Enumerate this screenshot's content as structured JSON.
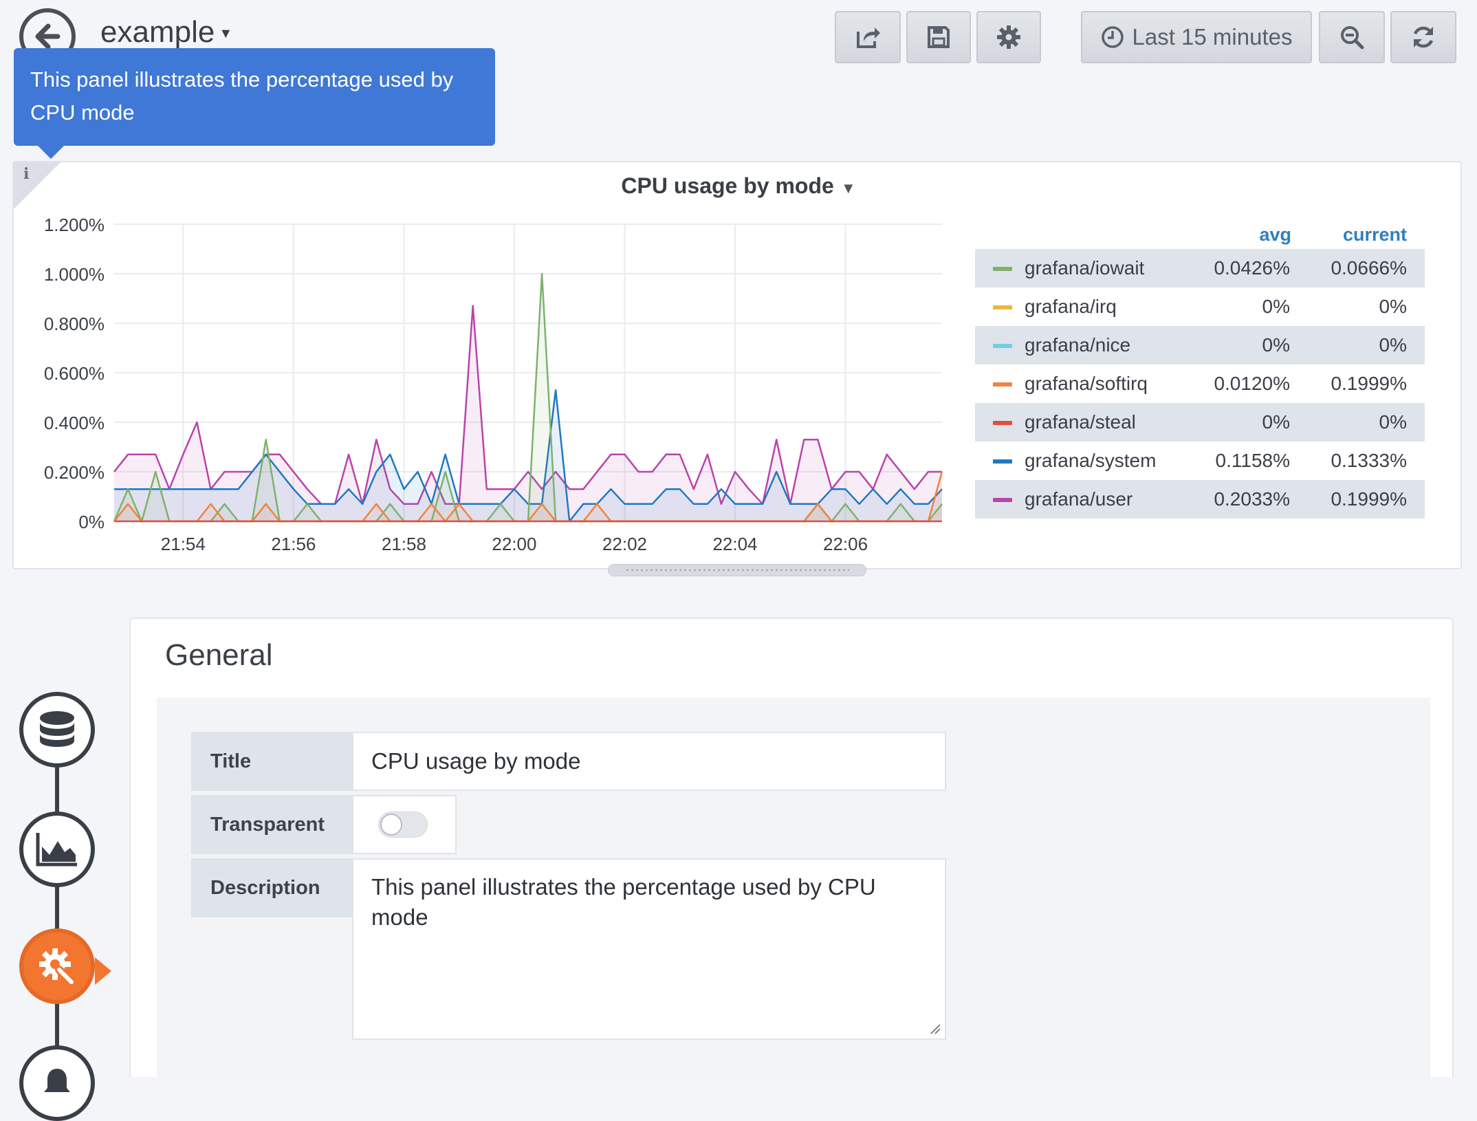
{
  "header": {
    "dashboard_title": "example",
    "time_range_label": "Last 15 minutes",
    "icons": [
      "back-arrow-icon",
      "share-icon",
      "save-icon",
      "gear-icon",
      "clock-icon",
      "zoom-out-icon",
      "refresh-icon"
    ]
  },
  "tooltip": {
    "text": "This panel illustrates the percentage used by CPU mode"
  },
  "panel": {
    "title": "CPU usage by mode",
    "info_icon": "i",
    "legend": {
      "col_avg": "avg",
      "col_current": "current",
      "rows": [
        {
          "name": "grafana/iowait",
          "avg": "0.0426%",
          "current": "0.0666%",
          "color": "#7eb26d"
        },
        {
          "name": "grafana/irq",
          "avg": "0%",
          "current": "0%",
          "color": "#eab839"
        },
        {
          "name": "grafana/nice",
          "avg": "0%",
          "current": "0%",
          "color": "#6ed0e0"
        },
        {
          "name": "grafana/softirq",
          "avg": "0.0120%",
          "current": "0.1999%",
          "color": "#ef843c"
        },
        {
          "name": "grafana/steal",
          "avg": "0%",
          "current": "0%",
          "color": "#e24d42"
        },
        {
          "name": "grafana/system",
          "avg": "0.1158%",
          "current": "0.1333%",
          "color": "#1f78c1"
        },
        {
          "name": "grafana/user",
          "avg": "0.2033%",
          "current": "0.1999%",
          "color": "#ba43a9"
        }
      ]
    }
  },
  "chart_data": {
    "type": "area",
    "title": "CPU usage by mode",
    "ylim": [
      0,
      1.2
    ],
    "y_ticks": [
      "0%",
      "0.200%",
      "0.400%",
      "0.600%",
      "0.800%",
      "1.000%",
      "1.200%"
    ],
    "x_ticks": [
      "21:54",
      "21:56",
      "21:58",
      "22:00",
      "22:02",
      "22:04",
      "22:06"
    ],
    "x_tick_positions_min": [
      2,
      4,
      6,
      8,
      10,
      12,
      14
    ],
    "xlim": [
      0.75,
      15.75
    ],
    "grid": true,
    "legend_position": "right",
    "series": [
      {
        "name": "grafana/user",
        "color": "#ba43a9",
        "x": [
          0.75,
          1,
          1.25,
          1.5,
          1.75,
          2,
          2.25,
          2.5,
          2.75,
          3,
          3.25,
          3.5,
          3.75,
          4,
          4.25,
          4.5,
          4.75,
          5,
          5.25,
          5.5,
          5.75,
          6,
          6.25,
          6.5,
          6.75,
          7,
          7.25,
          7.5,
          7.75,
          8,
          8.25,
          8.5,
          8.75,
          9,
          9.25,
          9.5,
          9.75,
          10,
          10.25,
          10.5,
          10.75,
          11,
          11.25,
          11.5,
          11.75,
          12,
          12.25,
          12.5,
          12.75,
          13,
          13.25,
          13.5,
          13.75,
          14,
          14.25,
          14.5,
          14.75,
          15,
          15.25,
          15.5,
          15.75
        ],
        "values": [
          0.2,
          0.27,
          0.27,
          0.27,
          0.13,
          0.27,
          0.4,
          0.13,
          0.2,
          0.2,
          0.2,
          0.27,
          0.27,
          0.2,
          0.13,
          0.07,
          0.07,
          0.27,
          0.07,
          0.33,
          0.13,
          0.07,
          0.07,
          0.2,
          0.07,
          0.07,
          0.87,
          0.13,
          0.13,
          0.13,
          0.2,
          0.13,
          0.2,
          0.13,
          0.13,
          0.2,
          0.27,
          0.27,
          0.2,
          0.2,
          0.27,
          0.27,
          0.13,
          0.27,
          0.07,
          0.2,
          0.13,
          0.07,
          0.33,
          0.07,
          0.33,
          0.33,
          0.13,
          0.2,
          0.2,
          0.13,
          0.27,
          0.2,
          0.13,
          0.2,
          0.2
        ]
      },
      {
        "name": "grafana/system",
        "color": "#1f78c1",
        "x": [
          0.75,
          1,
          1.25,
          1.5,
          1.75,
          2,
          2.25,
          2.5,
          2.75,
          3,
          3.25,
          3.5,
          3.75,
          4,
          4.25,
          4.5,
          4.75,
          5,
          5.25,
          5.5,
          5.75,
          6,
          6.25,
          6.5,
          6.75,
          7,
          7.25,
          7.5,
          7.75,
          8,
          8.25,
          8.5,
          8.75,
          9,
          9.25,
          9.5,
          9.75,
          10,
          10.25,
          10.5,
          10.75,
          11,
          11.25,
          11.5,
          11.75,
          12,
          12.25,
          12.5,
          12.75,
          13,
          13.25,
          13.5,
          13.75,
          14,
          14.25,
          14.5,
          14.75,
          15,
          15.25,
          15.5,
          15.75
        ],
        "values": [
          0.13,
          0.13,
          0.13,
          0.13,
          0.13,
          0.13,
          0.13,
          0.13,
          0.13,
          0.13,
          0.2,
          0.27,
          0.2,
          0.13,
          0.07,
          0.07,
          0.07,
          0.13,
          0.07,
          0.2,
          0.27,
          0.13,
          0.2,
          0.07,
          0.27,
          0.07,
          0.07,
          0.07,
          0.07,
          0.13,
          0.07,
          0.07,
          0.53,
          0,
          0.07,
          0.07,
          0.13,
          0.07,
          0.07,
          0.07,
          0.13,
          0.13,
          0.07,
          0.07,
          0.13,
          0.07,
          0.07,
          0.07,
          0.2,
          0.07,
          0.07,
          0.07,
          0.13,
          0.13,
          0.07,
          0.13,
          0.07,
          0.13,
          0.07,
          0.07,
          0.13
        ]
      },
      {
        "name": "grafana/iowait",
        "color": "#7eb26d",
        "x": [
          0.75,
          1,
          1.25,
          1.5,
          1.75,
          2,
          2.25,
          2.5,
          2.75,
          3,
          3.25,
          3.5,
          3.75,
          4,
          4.25,
          4.5,
          4.75,
          5,
          5.25,
          5.5,
          5.75,
          6,
          6.25,
          6.5,
          6.75,
          7,
          7.25,
          7.5,
          7.75,
          8,
          8.25,
          8.5,
          8.75,
          9,
          9.25,
          9.5,
          9.75,
          10,
          10.25,
          10.5,
          10.75,
          11,
          11.25,
          11.5,
          11.75,
          12,
          12.25,
          12.5,
          12.75,
          13,
          13.25,
          13.5,
          13.75,
          14,
          14.25,
          14.5,
          14.75,
          15,
          15.25,
          15.5,
          15.75
        ],
        "values": [
          0,
          0.13,
          0,
          0.2,
          0,
          0,
          0,
          0,
          0.07,
          0,
          0,
          0.33,
          0,
          0,
          0.07,
          0,
          0,
          0,
          0,
          0,
          0.07,
          0,
          0,
          0,
          0.2,
          0,
          0,
          0,
          0.07,
          0,
          0,
          1.0,
          0,
          0,
          0,
          0,
          0,
          0,
          0,
          0,
          0,
          0,
          0,
          0,
          0,
          0,
          0,
          0,
          0,
          0,
          0,
          0.07,
          0,
          0.07,
          0,
          0,
          0,
          0.07,
          0,
          0,
          0.07
        ]
      },
      {
        "name": "grafana/softirq",
        "color": "#ef843c",
        "x": [
          0.75,
          1,
          1.25,
          1.5,
          1.75,
          2,
          2.25,
          2.5,
          2.75,
          3,
          3.25,
          3.5,
          3.75,
          4,
          4.25,
          4.5,
          4.75,
          5,
          5.25,
          5.5,
          5.75,
          6,
          6.25,
          6.5,
          6.75,
          7,
          7.25,
          7.5,
          7.75,
          8,
          8.25,
          8.5,
          8.75,
          9,
          9.25,
          9.5,
          9.75,
          10,
          10.25,
          10.5,
          10.75,
          11,
          11.25,
          11.5,
          11.75,
          12,
          12.25,
          12.5,
          12.75,
          13,
          13.25,
          13.5,
          13.75,
          14,
          14.25,
          14.5,
          14.75,
          15,
          15.25,
          15.5,
          15.75
        ],
        "values": [
          0,
          0.07,
          0,
          0,
          0,
          0,
          0,
          0.07,
          0,
          0,
          0,
          0.07,
          0,
          0,
          0,
          0,
          0,
          0,
          0,
          0.07,
          0,
          0,
          0,
          0.07,
          0,
          0.07,
          0,
          0,
          0,
          0,
          0,
          0.07,
          0,
          0,
          0,
          0.07,
          0,
          0,
          0,
          0,
          0,
          0,
          0,
          0,
          0,
          0,
          0,
          0,
          0,
          0,
          0,
          0.07,
          0,
          0,
          0,
          0,
          0,
          0,
          0,
          0,
          0.2
        ]
      },
      {
        "name": "grafana/steal",
        "color": "#e24d42",
        "x": [
          0.75,
          15.75
        ],
        "values": [
          0,
          0
        ]
      }
    ]
  },
  "editor": {
    "section_title": "General",
    "fields": {
      "title_label": "Title",
      "title_value": "CPU usage by mode",
      "transparent_label": "Transparent",
      "transparent_on": false,
      "description_label": "Description",
      "description_value": "This panel illustrates the percentage used by CPU mode"
    },
    "steps": [
      {
        "name": "queries",
        "icon": "database-icon",
        "active": false
      },
      {
        "name": "visualization",
        "icon": "area-chart-icon",
        "active": false
      },
      {
        "name": "general",
        "icon": "gear-wrench-icon",
        "active": true
      },
      {
        "name": "alert",
        "icon": "bell-icon",
        "active": false
      }
    ]
  }
}
